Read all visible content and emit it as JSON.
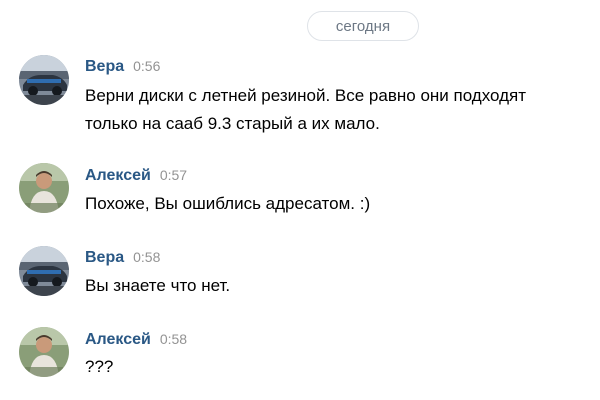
{
  "date_divider": "сегодня",
  "messages": [
    {
      "author": "Вера",
      "time": "0:56",
      "lines": [
        "Верни диски с летней резиной. Все равно они подходят",
        "только на сааб 9.3 старый а их мало."
      ],
      "avatar": "car-photo-avatar"
    },
    {
      "author": "Алексей",
      "time": "0:57",
      "lines": [
        "Похоже, Вы ошиблись адресатом. :)"
      ],
      "avatar": "person-photo-avatar"
    },
    {
      "author": "Вера",
      "time": "0:58",
      "lines": [
        "Вы знаете что нет."
      ],
      "avatar": "car-photo-avatar"
    },
    {
      "author": "Алексей",
      "time": "0:58",
      "lines": [
        "???"
      ],
      "avatar": "person-photo-avatar"
    }
  ]
}
